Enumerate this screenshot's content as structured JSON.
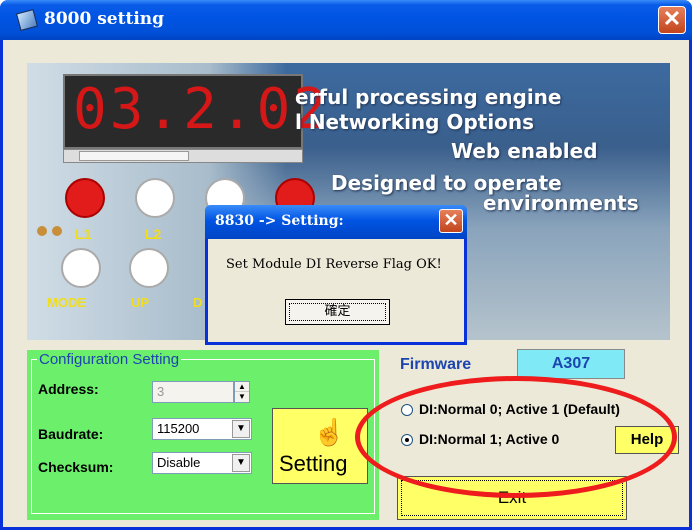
{
  "window": {
    "title": "8000 setting",
    "close_glyph": "✕"
  },
  "banner": {
    "led_digits": "03.2.02",
    "lines": [
      "erful processing engine",
      "l Networking Options",
      "Web enabled",
      "Designed to operate",
      "environments"
    ],
    "labels": {
      "l1": "L1",
      "l2": "L2",
      "mode": "MODE",
      "up": "UP",
      "d": "D"
    }
  },
  "dialog": {
    "title": "8830 -> Setting:",
    "message": "Set Module DI Reverse Flag OK!",
    "ok_label": "確定"
  },
  "config": {
    "legend": "Configuration Setting",
    "address_label": "Address:",
    "address_value": "3",
    "baudrate_label": "Baudrate:",
    "baudrate_value": "115200",
    "checksum_label": "Checksum:",
    "checksum_value": "Disable",
    "setting_button": "Setting"
  },
  "firmware": {
    "label": "Firmware",
    "value": "A307"
  },
  "di_options": [
    {
      "label": "DI:Normal 0;  Active 1 (Default)",
      "selected": false
    },
    {
      "label": "DI:Normal 1;  Active 0",
      "selected": true
    }
  ],
  "buttons": {
    "help": "Help",
    "exit": "Exit"
  },
  "icons": {
    "title": "app-icon",
    "setting": "hand-pointer-icon"
  },
  "colors": {
    "annotation": "#ee1c1c",
    "button_face": "#ffff66",
    "group_bg": "#6cf06c",
    "firmware_box": "#7fe9f6"
  }
}
